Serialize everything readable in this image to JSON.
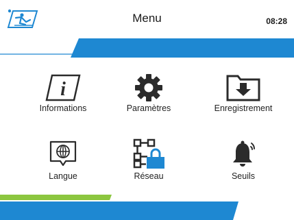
{
  "header": {
    "title": "Menu",
    "time": "08:28",
    "logo_icon": "person-skiing-logo"
  },
  "menu": {
    "items": [
      {
        "label": "Informations",
        "icon": "info-icon"
      },
      {
        "label": "Paramètres",
        "icon": "gear-icon"
      },
      {
        "label": "Enregistrement",
        "icon": "folder-download-icon"
      },
      {
        "label": "Langue",
        "icon": "globe-speech-icon"
      },
      {
        "label": "Réseau",
        "icon": "network-lock-icon"
      },
      {
        "label": "Seuils",
        "icon": "bell-alert-icon"
      }
    ]
  },
  "colors": {
    "accent_blue": "#1e88d2",
    "accent_green": "#8cc63f",
    "icon_dark": "#2b2b2b"
  }
}
